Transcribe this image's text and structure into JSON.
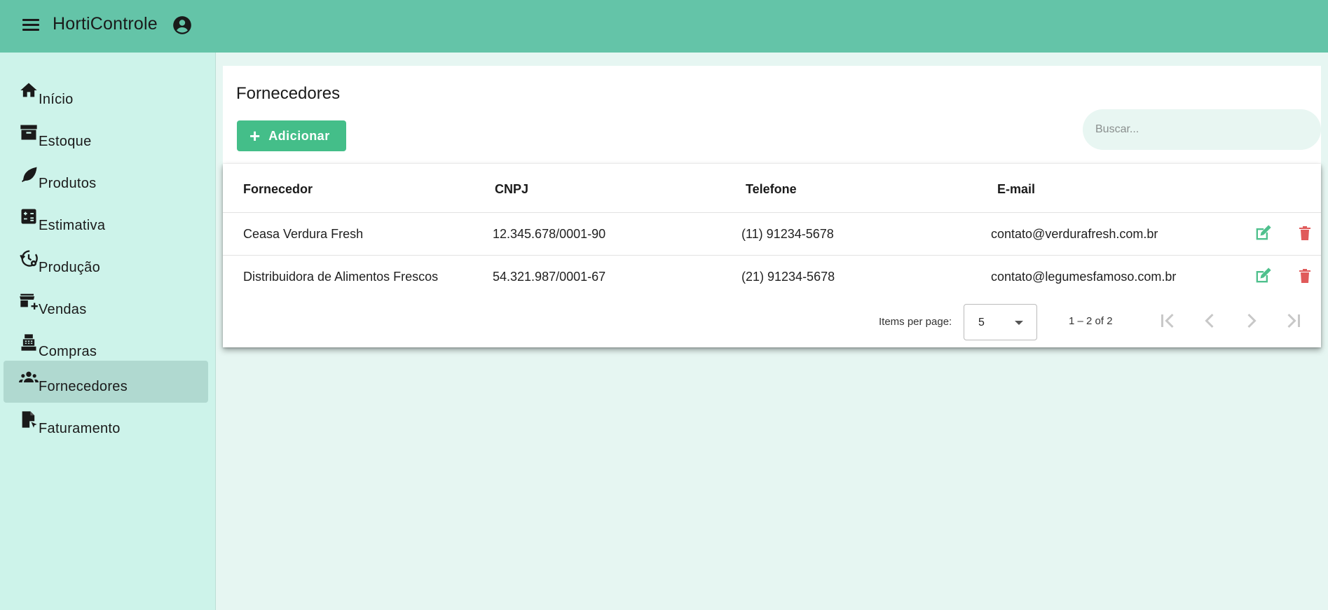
{
  "app": {
    "title": "HortiControle"
  },
  "sidebar": {
    "items": [
      {
        "label": "Início",
        "icon": "home-icon"
      },
      {
        "label": "Estoque",
        "icon": "archive-icon"
      },
      {
        "label": "Produtos",
        "icon": "leaf-icon"
      },
      {
        "label": "Estimativa",
        "icon": "calculator-icon"
      },
      {
        "label": "Produção",
        "icon": "history-gear-icon"
      },
      {
        "label": "Vendas",
        "icon": "storefront-add-icon"
      },
      {
        "label": "Compras",
        "icon": "cash-register-icon"
      },
      {
        "label": "Fornecedores",
        "icon": "groups-icon",
        "active": true
      },
      {
        "label": "Faturamento",
        "icon": "file-pointer-icon"
      }
    ]
  },
  "main": {
    "page_title": "Fornecedores",
    "add_label": "Adicionar",
    "search_placeholder": "Buscar..."
  },
  "table": {
    "headers": [
      "Fornecedor",
      "CNPJ",
      "Telefone",
      "E-mail"
    ],
    "rows": [
      [
        "Ceasa Verdura Fresh",
        "12.345.678/0001-90",
        "(11) 91234-5678",
        "contato@verdurafresh.com.br"
      ],
      [
        "Distribuidora de Alimentos Frescos",
        "54.321.987/0001-67",
        "(21) 91234-5678",
        "contato@legumesfamoso.com.br"
      ]
    ]
  },
  "pagination": {
    "items_per_page_label": "Items per page:",
    "page_size": "5",
    "range": "1 – 2 of 2"
  },
  "colors": {
    "topbar": "#64c4a8",
    "sidebar": "#cdf3ea",
    "accent": "#44be89",
    "edit": "#4fc08d",
    "delete": "#e05a5a"
  }
}
